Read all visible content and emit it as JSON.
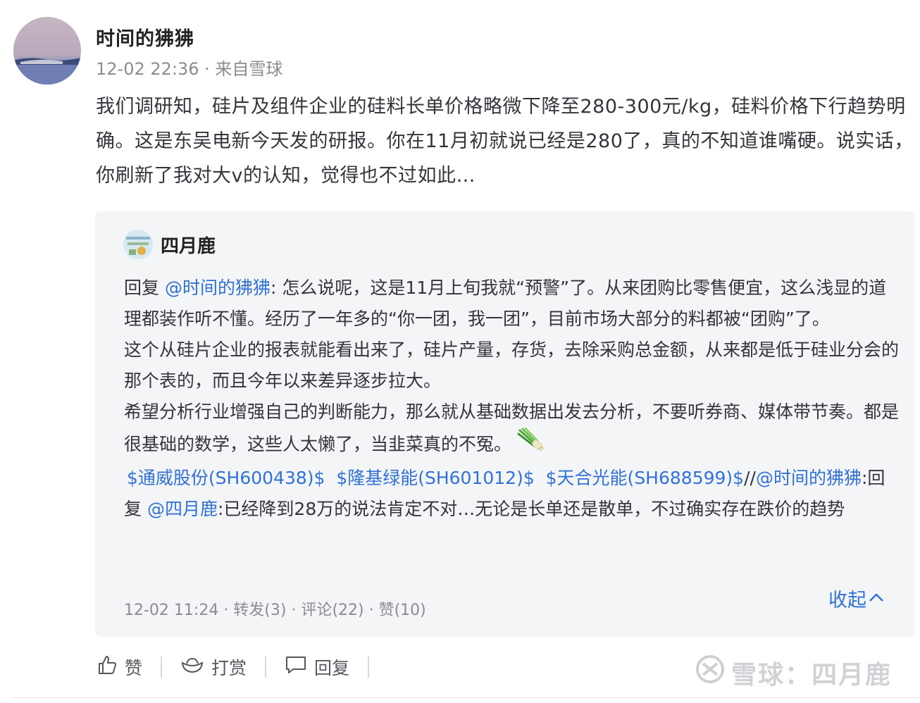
{
  "post": {
    "author": "时间的狒狒",
    "time": "12-02 22:36",
    "source": "· 来自雪球",
    "text": "我们调研知，硅片及组件企业的硅料长单价格略微下降至280-300元/kg，硅料价格下行趋势明确。这是东吴电新今天发的研报。你在11月初就说已经是280了，真的不知道谁嘴硬。说实话，你刷新了我对大v的认知，觉得也不过如此…"
  },
  "quote": {
    "author": "四月鹿",
    "reply_prefix": "回复",
    "mention1": "@时间的狒狒",
    "para1_text": ": 怎么说呢，这是11月上旬我就“预警”了。从来团购比零售便宜，这么浅显的道理都装作听不懂。经历了一年多的“你一团，我一团”，目前市场大部分的料都被“团购”了。",
    "para2": "这个从硅片企业的报表就能看出来了，硅片产量，存货，去除采购总金额，从来都是低于硅业分会的那个表的，而且今年以来差异逐步拉大。",
    "para3": "希望分析行业增强自己的判断能力，那么就从基础数据出发去分析，不要听券商、媒体带节奏。都是很基础的数学，这些人太懒了，当韭菜真的不冤。",
    "stock1": "$通威股份(SH600438)$",
    "stock2": "$隆基绿能(SH601012)$",
    "stock3": "$天合光能(SH688599)$",
    "slashes": "//",
    "mention2": "@时间的狒狒",
    "reply2": ":回复",
    "mention3": "@四月鹿",
    "para4_tail": ":已经降到28万的说法肯定不对…无论是长单还是散单，不过确实存在跌价的趋势",
    "footer": "12-02 11:24  · 转发(3) · 评论(22) · 赞(10)",
    "collapse_label": "收起"
  },
  "actions": {
    "like": "赞",
    "reward": "打赏",
    "reply": "回复"
  },
  "watermark": "雪球：四月鹿",
  "colors": {
    "link": "#3272d6",
    "card_bg": "#f4f5f6",
    "meta": "#8a8c92"
  }
}
